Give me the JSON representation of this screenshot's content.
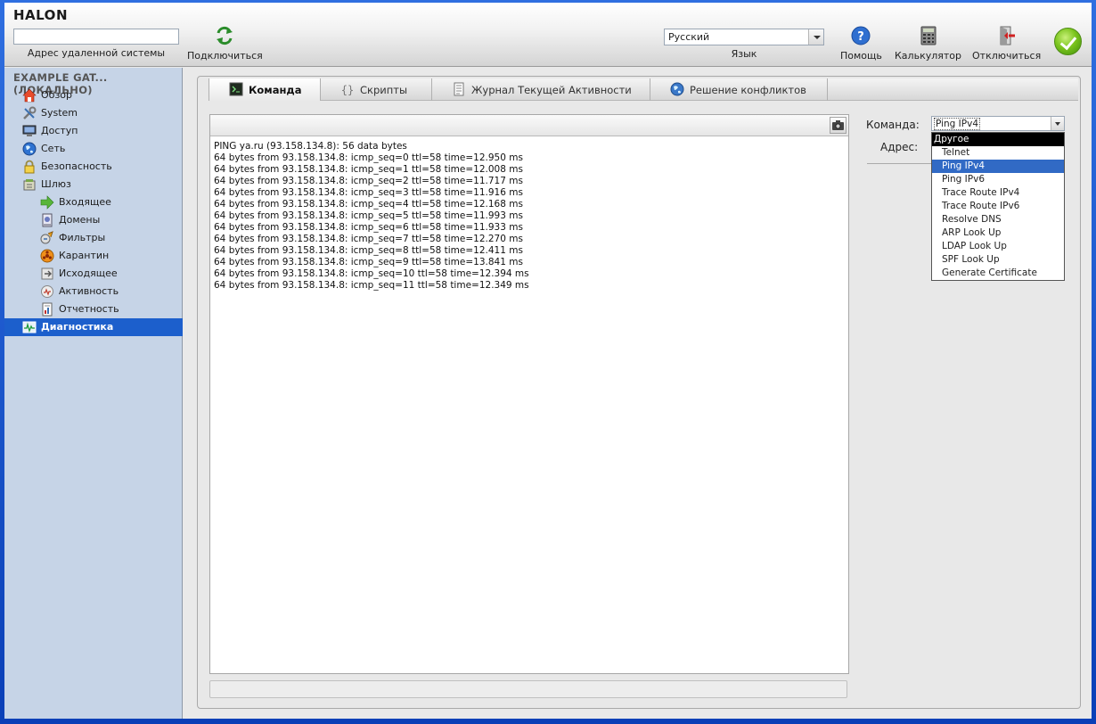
{
  "app": {
    "logo": "HALON"
  },
  "topbar": {
    "remote_value": "",
    "remote_label": "Адрес удаленной системы",
    "connect_label": "Подключиться",
    "language_value": "Русский",
    "language_label": "Язык",
    "help_label": "Помощь",
    "calculator_label": "Калькулятор",
    "disconnect_label": "Отключиться"
  },
  "sidebar": {
    "title": "EXAMPLE GAT... (ЛОКАЛЬНО)",
    "items": [
      {
        "label": "Обзор",
        "icon": "home-icon"
      },
      {
        "label": "System",
        "icon": "tools-icon"
      },
      {
        "label": "Доступ",
        "icon": "monitor-icon"
      },
      {
        "label": "Сеть",
        "icon": "globe-icon"
      },
      {
        "label": "Безопасность",
        "icon": "lock-icon"
      },
      {
        "label": "Шлюз",
        "icon": "gateway-icon"
      },
      {
        "label": "Входящее",
        "icon": "arrow-right-icon"
      },
      {
        "label": "Домены",
        "icon": "domain-icon"
      },
      {
        "label": "Фильтры",
        "icon": "filter-icon"
      },
      {
        "label": "Карантин",
        "icon": "biohazard-icon"
      },
      {
        "label": "Исходящее",
        "icon": "outgoing-icon"
      },
      {
        "label": "Активность",
        "icon": "activity-icon"
      },
      {
        "label": "Отчетность",
        "icon": "report-icon"
      },
      {
        "label": "Диагностика",
        "icon": "diagnostics-icon"
      }
    ]
  },
  "tabs": [
    {
      "label": "Команда",
      "icon": "terminal-icon"
    },
    {
      "label": "Скрипты",
      "icon": "braces-icon"
    },
    {
      "label": "Журнал Текущей Активности",
      "icon": "log-icon"
    },
    {
      "label": "Решение конфликтов",
      "icon": "globe-icon"
    }
  ],
  "output": {
    "lines": [
      "PING ya.ru (93.158.134.8): 56 data bytes",
      "64 bytes from 93.158.134.8: icmp_seq=0 ttl=58 time=12.950 ms",
      "64 bytes from 93.158.134.8: icmp_seq=1 ttl=58 time=12.008 ms",
      "64 bytes from 93.158.134.8: icmp_seq=2 ttl=58 time=11.717 ms",
      "64 bytes from 93.158.134.8: icmp_seq=3 ttl=58 time=11.916 ms",
      "64 bytes from 93.158.134.8: icmp_seq=4 ttl=58 time=12.168 ms",
      "64 bytes from 93.158.134.8: icmp_seq=5 ttl=58 time=11.993 ms",
      "64 bytes from 93.158.134.8: icmp_seq=6 ttl=58 time=11.933 ms",
      "64 bytes from 93.158.134.8: icmp_seq=7 ttl=58 time=12.270 ms",
      "64 bytes from 93.158.134.8: icmp_seq=8 ttl=58 time=12.411 ms",
      "64 bytes from 93.158.134.8: icmp_seq=9 ttl=58 time=13.841 ms",
      "64 bytes from 93.158.134.8: icmp_seq=10 ttl=58 time=12.394 ms",
      "64 bytes from 93.158.134.8: icmp_seq=11 ttl=58 time=12.349 ms"
    ]
  },
  "form": {
    "command_label": "Команда:",
    "command_value": "Ping IPv4",
    "address_label": "Адрес:",
    "dropdown_group": "Другое",
    "options": [
      "Telnet",
      "Ping IPv4",
      "Ping IPv6",
      "Trace Route IPv4",
      "Trace Route IPv6",
      "Resolve DNS",
      "ARP Look Up",
      "LDAP Look Up",
      "SPF Look Up",
      "Generate Certificate"
    ],
    "selected_option": "Ping IPv4"
  },
  "colors": {
    "accent": "#1c5fcc",
    "sidebar_bg": "#c6d4e7",
    "selection": "#316ac5",
    "ok_green": "#7cc51e"
  }
}
